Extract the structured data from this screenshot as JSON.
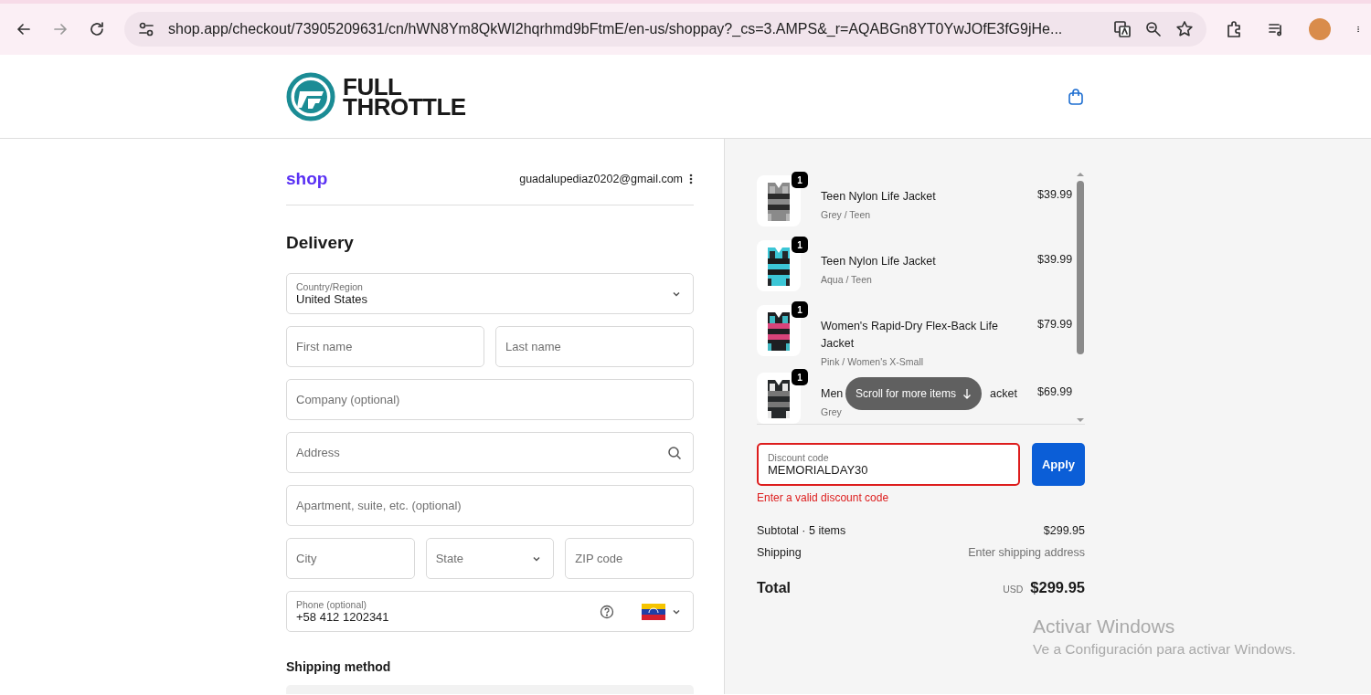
{
  "browser": {
    "url": "shop.app/checkout/73905209631/cn/hWN8Ym8QkWI2hqrhmd9bFtmE/en-us/shoppay?_cs=3.AMPS&_r=AQABGn8YT0YwJOfE3fG9jHe..."
  },
  "header": {
    "logo_top": "FULL",
    "logo_bottom": "THROTTLE"
  },
  "account": {
    "brand": "shop",
    "email": "guadalupediaz0202@gmail.com"
  },
  "delivery": {
    "title": "Delivery",
    "field_rows": [
      [
        {
          "kind": "select",
          "label": "Country/Region",
          "value": "United States"
        }
      ],
      [
        {
          "kind": "text",
          "placeholder": "First name"
        },
        {
          "kind": "text",
          "placeholder": "Last name"
        }
      ],
      [
        {
          "kind": "text",
          "placeholder": "Company (optional)"
        }
      ],
      [
        {
          "kind": "search",
          "placeholder": "Address"
        }
      ],
      [
        {
          "kind": "text",
          "placeholder": "Apartment, suite, etc. (optional)"
        }
      ],
      [
        {
          "kind": "text",
          "placeholder": "City"
        },
        {
          "kind": "select",
          "placeholder": "State"
        },
        {
          "kind": "text",
          "placeholder": "ZIP code"
        }
      ],
      [
        {
          "kind": "phone",
          "label": "Phone (optional)",
          "value": "+58 412 1202341"
        }
      ]
    ]
  },
  "shipping_method": {
    "title": "Shipping method"
  },
  "order": {
    "items": [
      {
        "name": "Teen Nylon Life Jacket",
        "variant": "Grey / Teen",
        "price": "$39.99",
        "quantity": "1"
      },
      {
        "name": "Teen Nylon Life Jacket",
        "variant": "Aqua / Teen",
        "price": "$39.99",
        "quantity": "1"
      },
      {
        "name": "Women's Rapid-Dry Flex-Back Life Jacket",
        "variant": "Pink / Women's X-Small",
        "price": "$79.99",
        "quantity": "1"
      },
      {
        "name_start": "Men",
        "name_end": "acket",
        "variant": "Grey",
        "price": "$69.99",
        "quantity": "1"
      }
    ],
    "scroll_hint": "Scroll for more items",
    "discount": {
      "label": "Discount code",
      "value": "MEMORIALDAY30",
      "error": true,
      "error_message": "Enter a valid discount code",
      "button": "Apply"
    },
    "subtotal": {
      "label": "Subtotal · 5 items",
      "value": "$299.95"
    },
    "shipping": {
      "label": "Shipping",
      "value": "Enter shipping address"
    },
    "total": {
      "label": "Total",
      "currency": "USD",
      "value": "$299.95"
    }
  },
  "watermark": {
    "title": "Activar Windows",
    "subtitle": "Ve a Configuración para activar Windows."
  }
}
